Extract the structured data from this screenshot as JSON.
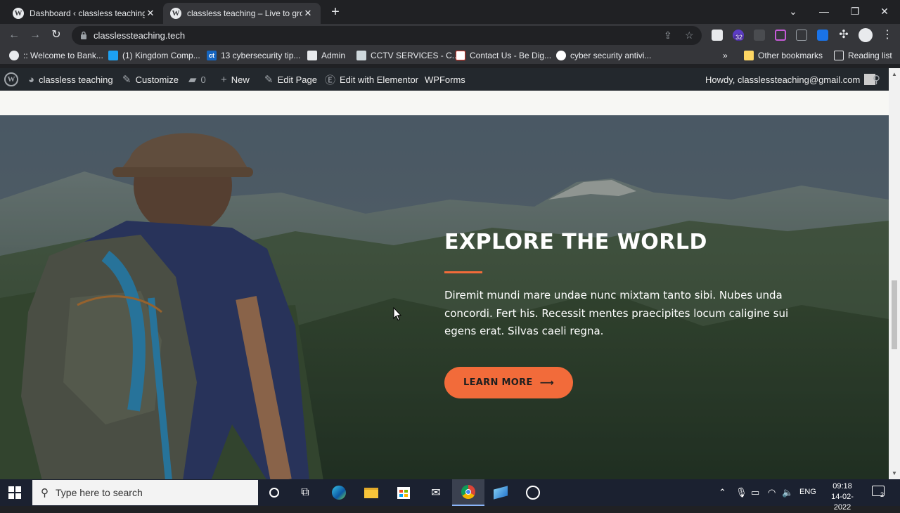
{
  "browser": {
    "tabs": [
      {
        "title": "Dashboard ‹ classless teaching —",
        "active": false,
        "favicon": "wordpress-icon"
      },
      {
        "title": "classless teaching – Live to grow",
        "active": true,
        "favicon": "wordpress-icon"
      }
    ],
    "url": "classlessteaching.tech",
    "extension_badge": "32",
    "bookmarks": [
      {
        "label": ":: Welcome to Bank...",
        "icon": "globe-icon"
      },
      {
        "label": "(1) Kingdom Comp...",
        "icon": "twitter-icon"
      },
      {
        "label": "13 cybersecurity tip...",
        "icon": "ct-icon",
        "icon_text": "ct"
      },
      {
        "label": "Admin",
        "icon": "admin-icon"
      },
      {
        "label": "CCTV SERVICES - C...",
        "icon": "cctv-icon"
      },
      {
        "label": "Contact Us - Be Dig...",
        "icon": "mail-icon"
      },
      {
        "label": "cyber security antivi...",
        "icon": "google-icon"
      }
    ],
    "bookmarks_overflow": "»",
    "other_bookmarks": "Other bookmarks",
    "reading_list": "Reading list"
  },
  "wp_admin_bar": {
    "site_name": "classless teaching",
    "customize": "Customize",
    "comments_count": "0",
    "new": "New",
    "edit_page": "Edit Page",
    "edit_elementor": "Edit with Elementor",
    "wpforms": "WPForms",
    "howdy": "Howdy, classlessteaching@gmail.com"
  },
  "hero": {
    "title": "EXPLORE THE WORLD",
    "text": "Diremit mundi mare undae nunc mixtam tanto sibi. Nubes unda concordi. Fert his. Recessit mentes praecipites locum caligine sui egens erat. Silvas caeli regna.",
    "button": "LEARN MORE",
    "button_arrow": "⟶",
    "accent_color": "#f26b3a"
  },
  "taskbar": {
    "search_placeholder": "Type here to search",
    "language": "ENG",
    "time": "09:18",
    "date": "14-02-2022",
    "notification_count": "2"
  }
}
